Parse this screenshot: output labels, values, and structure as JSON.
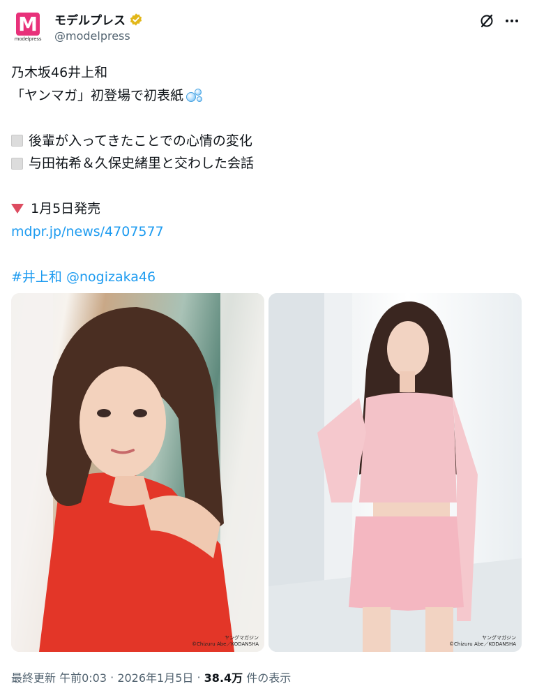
{
  "author": {
    "logo_text": "M",
    "logo_wordmark": "modelpress",
    "display_name": "モデルプレス",
    "handle": "@modelpress",
    "verified_badge": "gold-verified-icon"
  },
  "header_actions": {
    "grok": "grok-icon",
    "more": "more-options-icon"
  },
  "post": {
    "line1": "乃木坂46井上和",
    "line2": "「ヤンマガ」初登場で初表紙",
    "line2_emoji": "bubbles-icon",
    "bullet1": "後輩が入ってきたことでの心情の変化",
    "bullet2": "与田祐希＆久保史緒里と交わした会話",
    "release": "1月5日発売",
    "link": "mdpr.jp/news/4707577",
    "hashtag": "#井上和",
    "mention": "@nogizaka46"
  },
  "media": [
    {
      "credit_line1": "ヤングマガジン",
      "credit_line2": "©Chizuru Abe／KODANSHA"
    },
    {
      "credit_line1": "ヤングマガジン",
      "credit_line2": "©Chizuru Abe／KODANSHA"
    }
  ],
  "footer": {
    "updated_label": "最終更新",
    "time": "午前0:03",
    "sep1": " · ",
    "date": "2026年1月5日",
    "sep2": " · ",
    "views_count": "38.4万",
    "views_label": "件の表示"
  },
  "colors": {
    "link": "#1d9bf0",
    "logo": "#e8317a",
    "badge": "#e2b719",
    "triangle": "#dd4c60"
  }
}
